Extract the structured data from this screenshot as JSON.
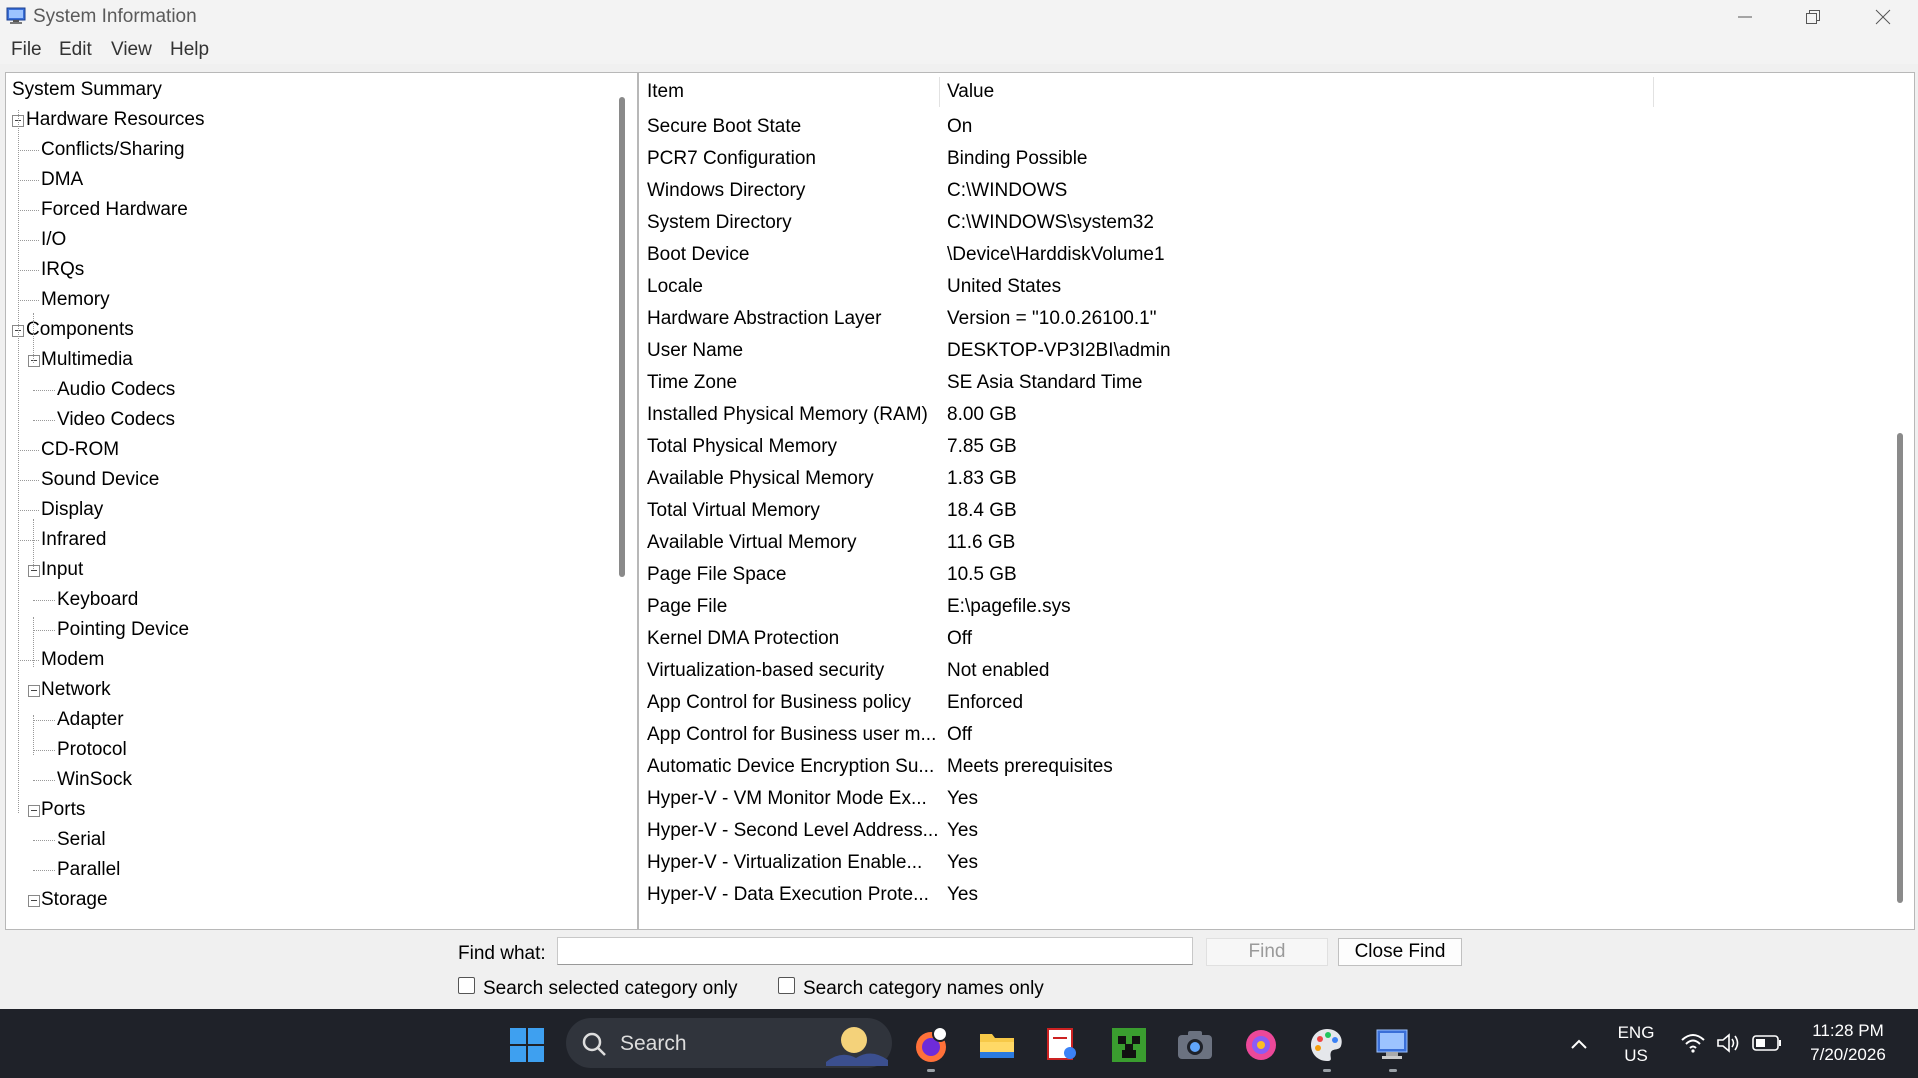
{
  "window": {
    "title": "System Information",
    "icon": "system-information-icon"
  },
  "menu": [
    "File",
    "Edit",
    "View",
    "Help"
  ],
  "tree": [
    {
      "label": "System Summary",
      "level": 0,
      "expander": false
    },
    {
      "label": "Hardware Resources",
      "level": 1,
      "expander": true
    },
    {
      "label": "Conflicts/Sharing",
      "level": 2,
      "expander": false
    },
    {
      "label": "DMA",
      "level": 2,
      "expander": false
    },
    {
      "label": "Forced Hardware",
      "level": 2,
      "expander": false
    },
    {
      "label": "I/O",
      "level": 2,
      "expander": false
    },
    {
      "label": "IRQs",
      "level": 2,
      "expander": false
    },
    {
      "label": "Memory",
      "level": 2,
      "expander": false
    },
    {
      "label": "Components",
      "level": 1,
      "expander": true
    },
    {
      "label": "Multimedia",
      "level": 2,
      "expander": true
    },
    {
      "label": "Audio Codecs",
      "level": 3,
      "expander": false
    },
    {
      "label": "Video Codecs",
      "level": 3,
      "expander": false
    },
    {
      "label": "CD-ROM",
      "level": 2,
      "expander": false
    },
    {
      "label": "Sound Device",
      "level": 2,
      "expander": false
    },
    {
      "label": "Display",
      "level": 2,
      "expander": false
    },
    {
      "label": "Infrared",
      "level": 2,
      "expander": false
    },
    {
      "label": "Input",
      "level": 2,
      "expander": true
    },
    {
      "label": "Keyboard",
      "level": 3,
      "expander": false
    },
    {
      "label": "Pointing Device",
      "level": 3,
      "expander": false
    },
    {
      "label": "Modem",
      "level": 2,
      "expander": false
    },
    {
      "label": "Network",
      "level": 2,
      "expander": true
    },
    {
      "label": "Adapter",
      "level": 3,
      "expander": false
    },
    {
      "label": "Protocol",
      "level": 3,
      "expander": false
    },
    {
      "label": "WinSock",
      "level": 3,
      "expander": false
    },
    {
      "label": "Ports",
      "level": 2,
      "expander": true
    },
    {
      "label": "Serial",
      "level": 3,
      "expander": false
    },
    {
      "label": "Parallel",
      "level": 3,
      "expander": false
    },
    {
      "label": "Storage",
      "level": 2,
      "expander": true
    }
  ],
  "table": {
    "columns": [
      "Item",
      "Value"
    ],
    "rows": [
      {
        "item": "Secure Boot State",
        "value": "On"
      },
      {
        "item": "PCR7 Configuration",
        "value": "Binding Possible"
      },
      {
        "item": "Windows Directory",
        "value": "C:\\WINDOWS"
      },
      {
        "item": "System Directory",
        "value": "C:\\WINDOWS\\system32"
      },
      {
        "item": "Boot Device",
        "value": "\\Device\\HarddiskVolume1"
      },
      {
        "item": "Locale",
        "value": "United States"
      },
      {
        "item": "Hardware Abstraction Layer",
        "value": "Version = \"10.0.26100.1\""
      },
      {
        "item": "User Name",
        "value": "DESKTOP-VP3I2BI\\admin"
      },
      {
        "item": "Time Zone",
        "value": "SE Asia Standard Time"
      },
      {
        "item": "Installed Physical Memory (RAM)",
        "value": "8.00 GB"
      },
      {
        "item": "Total Physical Memory",
        "value": "7.85 GB"
      },
      {
        "item": "Available Physical Memory",
        "value": "1.83 GB"
      },
      {
        "item": "Total Virtual Memory",
        "value": "18.4 GB"
      },
      {
        "item": "Available Virtual Memory",
        "value": "11.6 GB"
      },
      {
        "item": "Page File Space",
        "value": "10.5 GB"
      },
      {
        "item": "Page File",
        "value": "E:\\pagefile.sys"
      },
      {
        "item": "Kernel DMA Protection",
        "value": "Off"
      },
      {
        "item": "Virtualization-based security",
        "value": "Not enabled"
      },
      {
        "item": "App Control for Business policy",
        "value": "Enforced"
      },
      {
        "item": "App Control for Business user m...",
        "value": "Off"
      },
      {
        "item": "Automatic Device Encryption Su...",
        "value": "Meets prerequisites"
      },
      {
        "item": "Hyper-V - VM Monitor Mode Ex...",
        "value": "Yes"
      },
      {
        "item": "Hyper-V - Second Level Address...",
        "value": "Yes"
      },
      {
        "item": "Hyper-V - Virtualization Enable...",
        "value": "Yes"
      },
      {
        "item": "Hyper-V - Data Execution Prote...",
        "value": "Yes"
      }
    ]
  },
  "find": {
    "label": "Find what:",
    "value": "",
    "find_button": "Find",
    "close_button": "Close Find",
    "check_selected": "Search selected category only",
    "check_names": "Search category names only"
  },
  "taskbar": {
    "search_label": "Search",
    "language": "ENG",
    "region": "US",
    "time": "11:28 PM",
    "date": "7/20/2026"
  }
}
